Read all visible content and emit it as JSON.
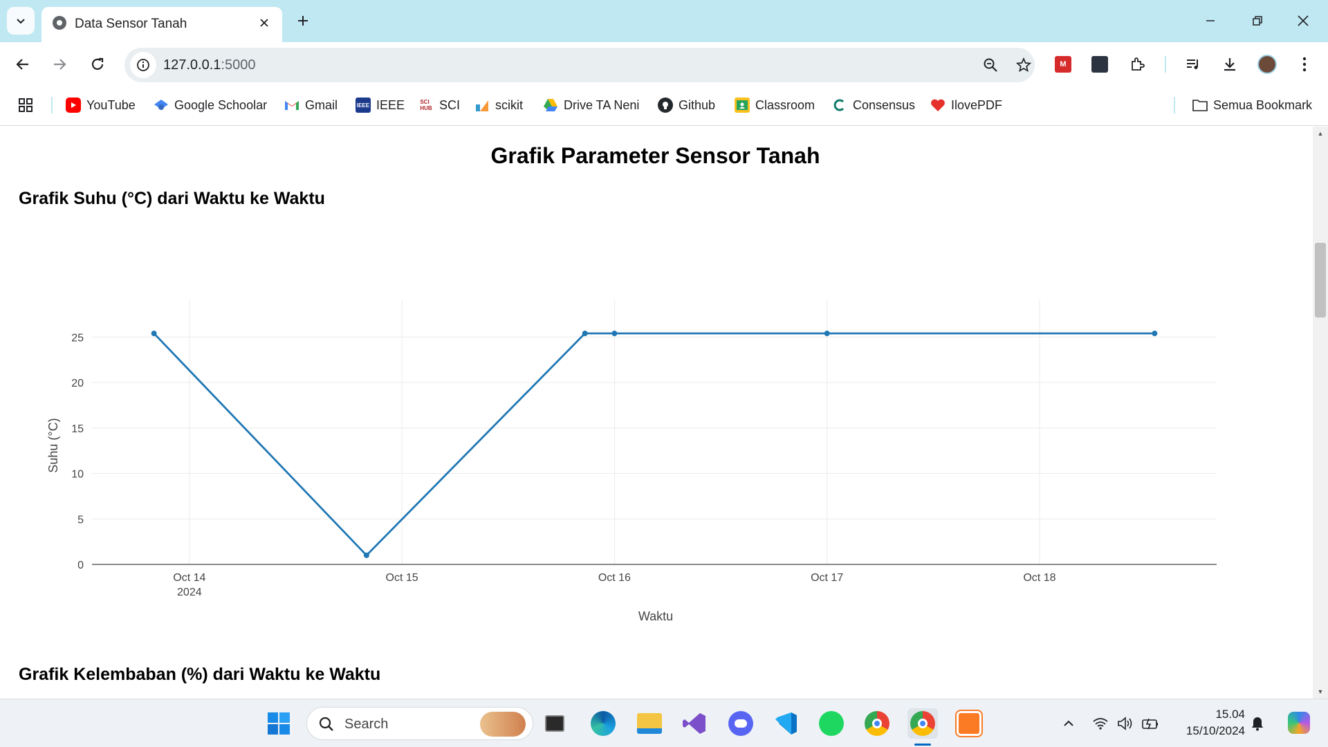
{
  "browser": {
    "tab": {
      "title": "Data Sensor Tanah"
    },
    "url": {
      "host": "127.0.0.1",
      "port": ":5000"
    },
    "bookmarks": [
      {
        "label": "YouTube",
        "icon": "youtube-icon"
      },
      {
        "label": "Google Schoolar",
        "icon": "google-scholar-icon"
      },
      {
        "label": "Gmail",
        "icon": "gmail-icon"
      },
      {
        "label": "IEEE",
        "icon": "ieee-icon"
      },
      {
        "label": "SCI",
        "icon": "sci-hub-icon"
      },
      {
        "label": "scikit",
        "icon": "scikit-icon"
      },
      {
        "label": "Drive TA Neni",
        "icon": "google-drive-icon"
      },
      {
        "label": "Github",
        "icon": "github-icon"
      },
      {
        "label": "Classroom",
        "icon": "classroom-icon"
      },
      {
        "label": "Consensus",
        "icon": "consensus-icon"
      },
      {
        "label": "IlovePDF",
        "icon": "ilovepdf-icon"
      }
    ],
    "all_bookmarks": "Semua Bookmark"
  },
  "page": {
    "title": "Grafik Parameter Sensor Tanah",
    "section1_title": "Grafik Suhu (°C) dari Waktu ke Waktu",
    "section2_title": "Grafik Kelembaban (%) dari Waktu ke Waktu"
  },
  "chart_data": {
    "type": "line",
    "title": "",
    "xlabel": "Waktu",
    "ylabel": "Suhu (°C)",
    "x": [
      "2024-10-13 20:00",
      "2024-10-14 20:00",
      "2024-10-15 20:40",
      "2024-10-16 00:00",
      "2024-10-17 00:00",
      "2024-10-18 13:00"
    ],
    "y": [
      25.4,
      1.0,
      25.4,
      25.4,
      25.4,
      25.4
    ],
    "xlim": [
      "2024-10-13 13:00",
      "2024-10-18 20:00"
    ],
    "ylim": [
      0,
      27
    ],
    "yticks": [
      0,
      5,
      10,
      15,
      20,
      25
    ],
    "xticks": [
      {
        "date": "2024-10-14",
        "label": "Oct 14",
        "sublabel": "2024"
      },
      {
        "date": "2024-10-15",
        "label": "Oct 15",
        "sublabel": ""
      },
      {
        "date": "2024-10-16",
        "label": "Oct 16",
        "sublabel": ""
      },
      {
        "date": "2024-10-17",
        "label": "Oct 17",
        "sublabel": ""
      },
      {
        "date": "2024-10-18",
        "label": "Oct 18",
        "sublabel": ""
      }
    ],
    "grid": true,
    "line_color": "#1f77b4"
  },
  "taskbar": {
    "search_placeholder": "Search",
    "time": "15.04",
    "date": "15/10/2024",
    "apps": [
      "start-icon",
      "file-explorer-icon",
      "edge-icon",
      "folder-icon",
      "visual-studio-icon",
      "discord-icon",
      "vscode-icon",
      "spotify-icon",
      "chrome-icon",
      "chrome-profile-icon",
      "xampp-icon"
    ]
  }
}
